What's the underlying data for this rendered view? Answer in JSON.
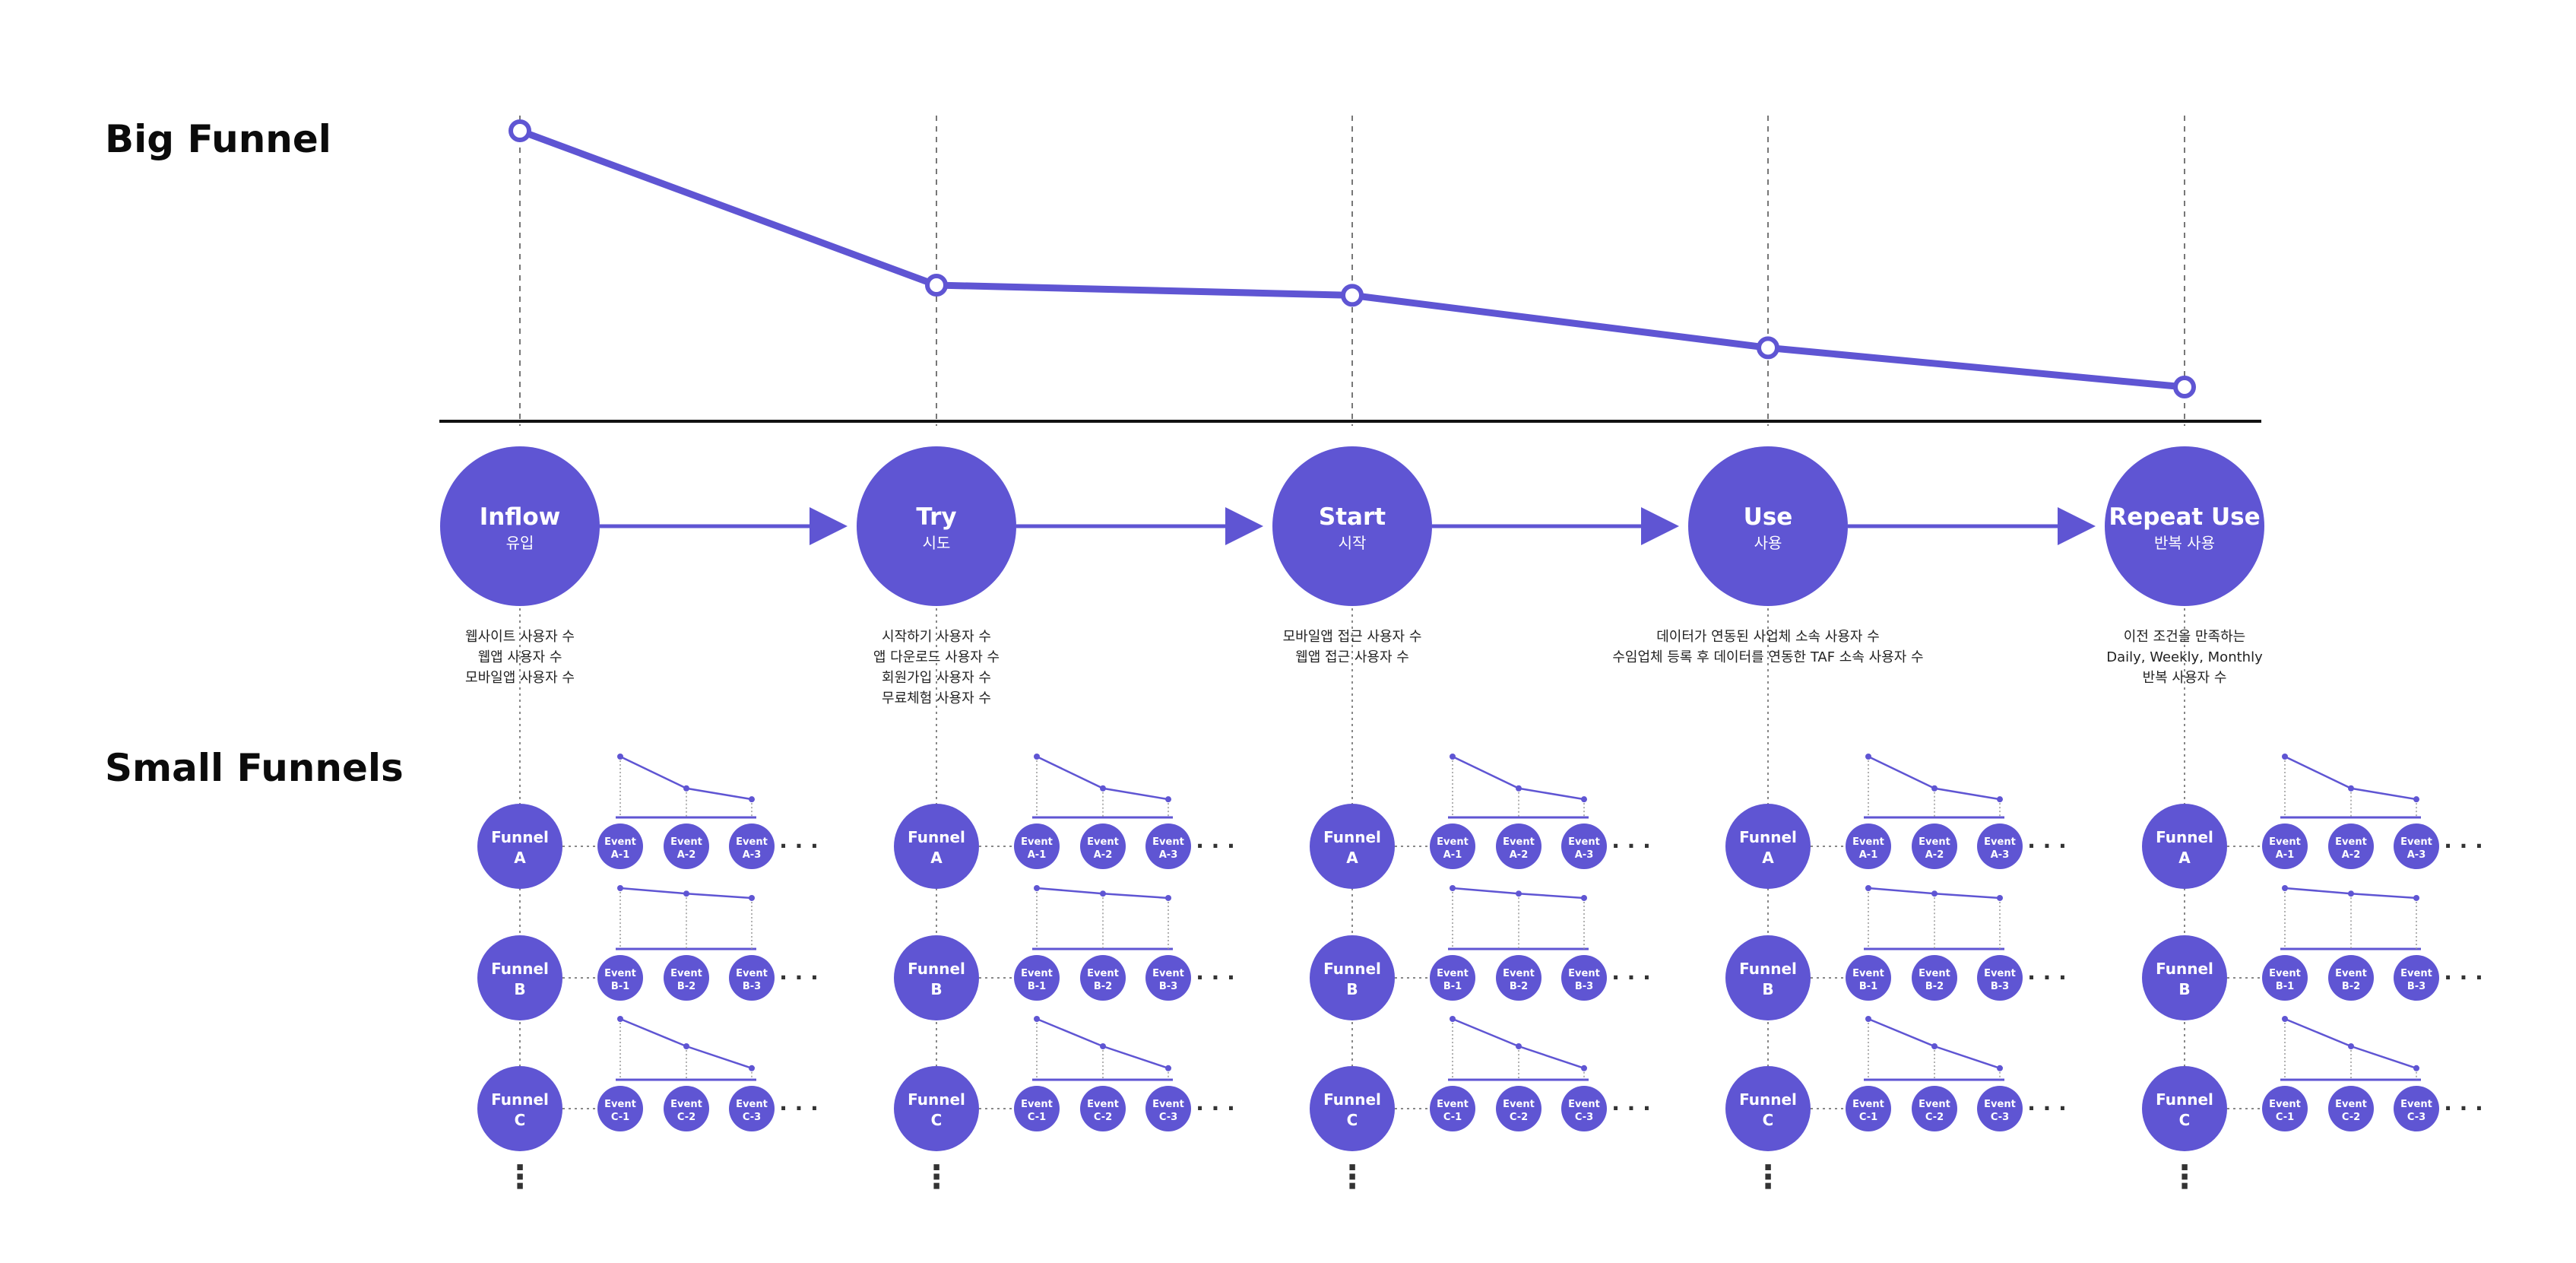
{
  "colors": {
    "accent": "#5f55d3",
    "line": "#111111",
    "guide": "#777777"
  },
  "big_funnel": {
    "title": "Big Funnel",
    "chart_data": {
      "type": "line",
      "categories": [
        "Inflow",
        "Try",
        "Start",
        "Use",
        "Repeat Use"
      ],
      "values": [
        1.0,
        0.47,
        0.435,
        0.255,
        0.12
      ],
      "ylim": [
        0,
        1
      ],
      "grid": "vertical-dashed"
    }
  },
  "stages": [
    {
      "title": "Inflow",
      "sub": "유입",
      "desc": [
        "웹사이트 사용자 수",
        "웹앱 사용자 수",
        "모바일앱 사용자 수"
      ]
    },
    {
      "title": "Try",
      "sub": "시도",
      "desc": [
        "시작하기 사용자 수",
        "앱 다운로드 사용자 수",
        "회원가입 사용자 수",
        "무료체험 사용자 수"
      ]
    },
    {
      "title": "Start",
      "sub": "시작",
      "desc": [
        "모바일앱 접근 사용자 수",
        "웹앱 접근 사용자 수"
      ]
    },
    {
      "title": "Use",
      "sub": "사용",
      "desc": [
        "데이터가 연동된 사업체 소속 사용자 수",
        "수임업체 등록 후 데이터를 연동한 TAF 소속 사용자 수"
      ]
    },
    {
      "title": "Repeat Use",
      "sub": "반복 사용",
      "desc": [
        "이전 조건을 만족하는",
        "Daily, Weekly, Monthly",
        "반복 사용자 수"
      ]
    }
  ],
  "small_funnels": {
    "title": "Small Funnels",
    "funnel_word": "Funnel",
    "event_word": "Event",
    "ellipsis": "· · ·",
    "vertical_ellipsis": "⋮",
    "rows": [
      {
        "letter": "A",
        "events": [
          "A-1",
          "A-2",
          "A-3"
        ],
        "trend": [
          1.0,
          0.42,
          0.22
        ]
      },
      {
        "letter": "B",
        "events": [
          "B-1",
          "B-2",
          "B-3"
        ],
        "trend": [
          1.0,
          0.9,
          0.82
        ]
      },
      {
        "letter": "C",
        "events": [
          "C-1",
          "C-2",
          "C-3"
        ],
        "trend": [
          1.0,
          0.5,
          0.1
        ]
      }
    ]
  }
}
